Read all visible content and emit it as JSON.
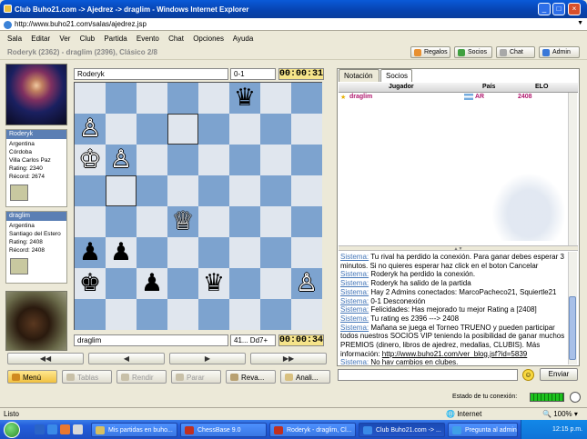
{
  "window": {
    "title": "Club Buho21.com -> Ajedrez -> draglim - Windows Internet Explorer",
    "address": "http://www.buho21.com/salas/ajedrez.jsp"
  },
  "menu": [
    "Sala",
    "Editar",
    "Ver",
    "Club",
    "Partida",
    "Evento",
    "Chat",
    "Opciones",
    "Ayuda"
  ],
  "players_bar": "Roderyk (2362) - draglim (2396), Clásico 2/8",
  "toolbar": {
    "regalos": "Regalos",
    "socios": "Socios",
    "chat": "Chat",
    "admin": "Admin"
  },
  "top_player": {
    "name": "Roderyk",
    "score": "0-1",
    "clock": "00:00:31"
  },
  "bottom_player": {
    "name": "draglim",
    "move": "41... Dd7+",
    "clock": "00:00:34"
  },
  "player1": {
    "name": "Roderyk",
    "country": "Argentina",
    "city": "Córdoba",
    "town": "Villa Carlos Paz",
    "rating": "Rating: 2340",
    "record": "Récord: 2674"
  },
  "player2": {
    "name": "draglim",
    "country": "Argentina",
    "city": "Santiago del Estero",
    "rating": "Rating: 2408",
    "record": "Récord: 2408"
  },
  "nav": {
    "first": "◀◀",
    "prev": "◀",
    "next": "▶",
    "last": "▶▶"
  },
  "actions": {
    "menu": "Menú",
    "tablas": "Tablas",
    "rendir": "Rendir",
    "parar": "Parar",
    "revancha": "Reva...",
    "analizar": "Anali..."
  },
  "tabs": {
    "notacion": "Notación",
    "socios": "Socios"
  },
  "table": {
    "headers": {
      "jugador": "Jugador",
      "pais": "País",
      "elo": "ELO"
    },
    "row": {
      "name": "draglim",
      "country": "AR",
      "elo": "2408"
    }
  },
  "chat": {
    "lines": [
      {
        "sys": "Sistema:",
        "text": " Tu rival ha perdido la conexión. Para ganar debes esperar 3 minutos. Si no quieres esperar haz click en el boton Cancelar"
      },
      {
        "sys": "Sistema:",
        "text": " Roderyk ha perdido la conexión."
      },
      {
        "sys": "Sistema:",
        "text": " Roderyk ha salido de la partida"
      },
      {
        "sys": "Sistema:",
        "text": " Hay 2 Admins conectados:  MarcoPacheco21, Squiertle21"
      },
      {
        "sys": "Sistema:",
        "text": " 0-1 Desconexión"
      },
      {
        "sys": "Sistema:",
        "text": " Felicidades: Has mejorado tu mejor Rating a [2408]"
      },
      {
        "sys": "Sistema:",
        "text": " Tu rating es 2396 ---> 2408"
      },
      {
        "sys": "Sistema:",
        "text": " Mañana se juega el Torneo TRUENO y pueden participar todos nuestros SOCIOS VIP teniendo la posibilidad de ganar muchos PREMIOS (dinero, libros de ajedrez, medallas, CLUBIS). Más información:  ",
        "link": "http://www.buho21.com/ver_blog.jsf?id=5839"
      },
      {
        "sys": "Sistema:",
        "text": " No hay cambios en clubes."
      }
    ],
    "send": "Enviar"
  },
  "connection_label": "Estado de tu conexión:",
  "status": {
    "left": "Listo",
    "zone": "Internet",
    "zoom": "100%"
  },
  "taskbar": {
    "tasks": [
      "Mis partidas en buho...",
      "ChessBase 9.0",
      "Roderyk - draglim, Cl...",
      "Club Buho21.com -> ...",
      "Pregunta al admin"
    ],
    "time": "12:15 p.m."
  },
  "board": {
    "highlight": [
      "d7",
      "b5"
    ],
    "pieces": [
      {
        "sq": "f8",
        "p": "♛",
        "c": "b"
      },
      {
        "sq": "a7",
        "p": "♙",
        "c": "w"
      },
      {
        "sq": "a6",
        "p": "♔",
        "c": "w"
      },
      {
        "sq": "b6",
        "p": "♙",
        "c": "w"
      },
      {
        "sq": "d4",
        "p": "♕",
        "c": "w"
      },
      {
        "sq": "a3",
        "p": "♟",
        "c": "b"
      },
      {
        "sq": "b3",
        "p": "♟",
        "c": "b"
      },
      {
        "sq": "a2",
        "p": "♚",
        "c": "b"
      },
      {
        "sq": "c2",
        "p": "♟",
        "c": "b"
      },
      {
        "sq": "e2",
        "p": "♛",
        "c": "b"
      },
      {
        "sq": "h2",
        "p": "♙",
        "c": "w"
      }
    ]
  }
}
